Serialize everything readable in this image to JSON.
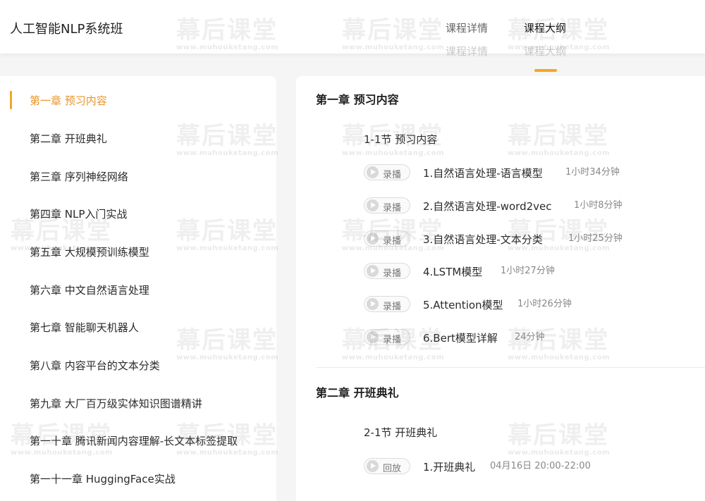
{
  "header": {
    "course_title": "人工智能NLP系统班",
    "tabs": [
      {
        "label": "课程详情"
      },
      {
        "label": "课程大纲"
      }
    ],
    "accent_color": "#f5a623"
  },
  "sidebar": {
    "chapters": [
      {
        "label": "第一章 预习内容"
      },
      {
        "label": "第二章 开班典礼"
      },
      {
        "label": "第三章 序列神经网络"
      },
      {
        "label": "第四章 NLP入门实战"
      },
      {
        "label": "第五章 大规模预训练模型"
      },
      {
        "label": "第六章 中文自然语言处理"
      },
      {
        "label": "第七章 智能聊天机器人"
      },
      {
        "label": "第八章 内容平台的文本分类"
      },
      {
        "label": "第九章 大厂百万级实体知识图谱精讲"
      },
      {
        "label": "第一十章 腾讯新闻内容理解-长文本标签提取"
      },
      {
        "label": "第一十一章 HuggingFace实战"
      }
    ]
  },
  "content": {
    "chapters": [
      {
        "title": "第一章 预习内容",
        "section": "1-1节 预习内容",
        "lessons": [
          {
            "badge": "录播",
            "title": "1.自然语言处理-语言模型",
            "duration": "1小时34分钟"
          },
          {
            "badge": "录播",
            "title": "2.自然语言处理-word2vec",
            "duration": "1小时8分钟"
          },
          {
            "badge": "录播",
            "title": "3.自然语言处理-文本分类",
            "duration": "1小时25分钟"
          },
          {
            "badge": "录播",
            "title": "4.LSTM模型",
            "duration": "1小时27分钟"
          },
          {
            "badge": "录播",
            "title": "5.Attention模型",
            "duration": "1小时26分钟"
          },
          {
            "badge": "录播",
            "title": "6.Bert模型详解",
            "duration": "24分钟"
          }
        ]
      },
      {
        "title": "第二章 开班典礼",
        "section": "2-1节 开班典礼",
        "lessons": [
          {
            "badge": "回放",
            "title": "1.开班典礼",
            "duration": "04月16日 20:00-22:00"
          }
        ]
      }
    ]
  },
  "watermark": {
    "cn": "幕后课堂",
    "en": "www.muhouketang.com"
  }
}
